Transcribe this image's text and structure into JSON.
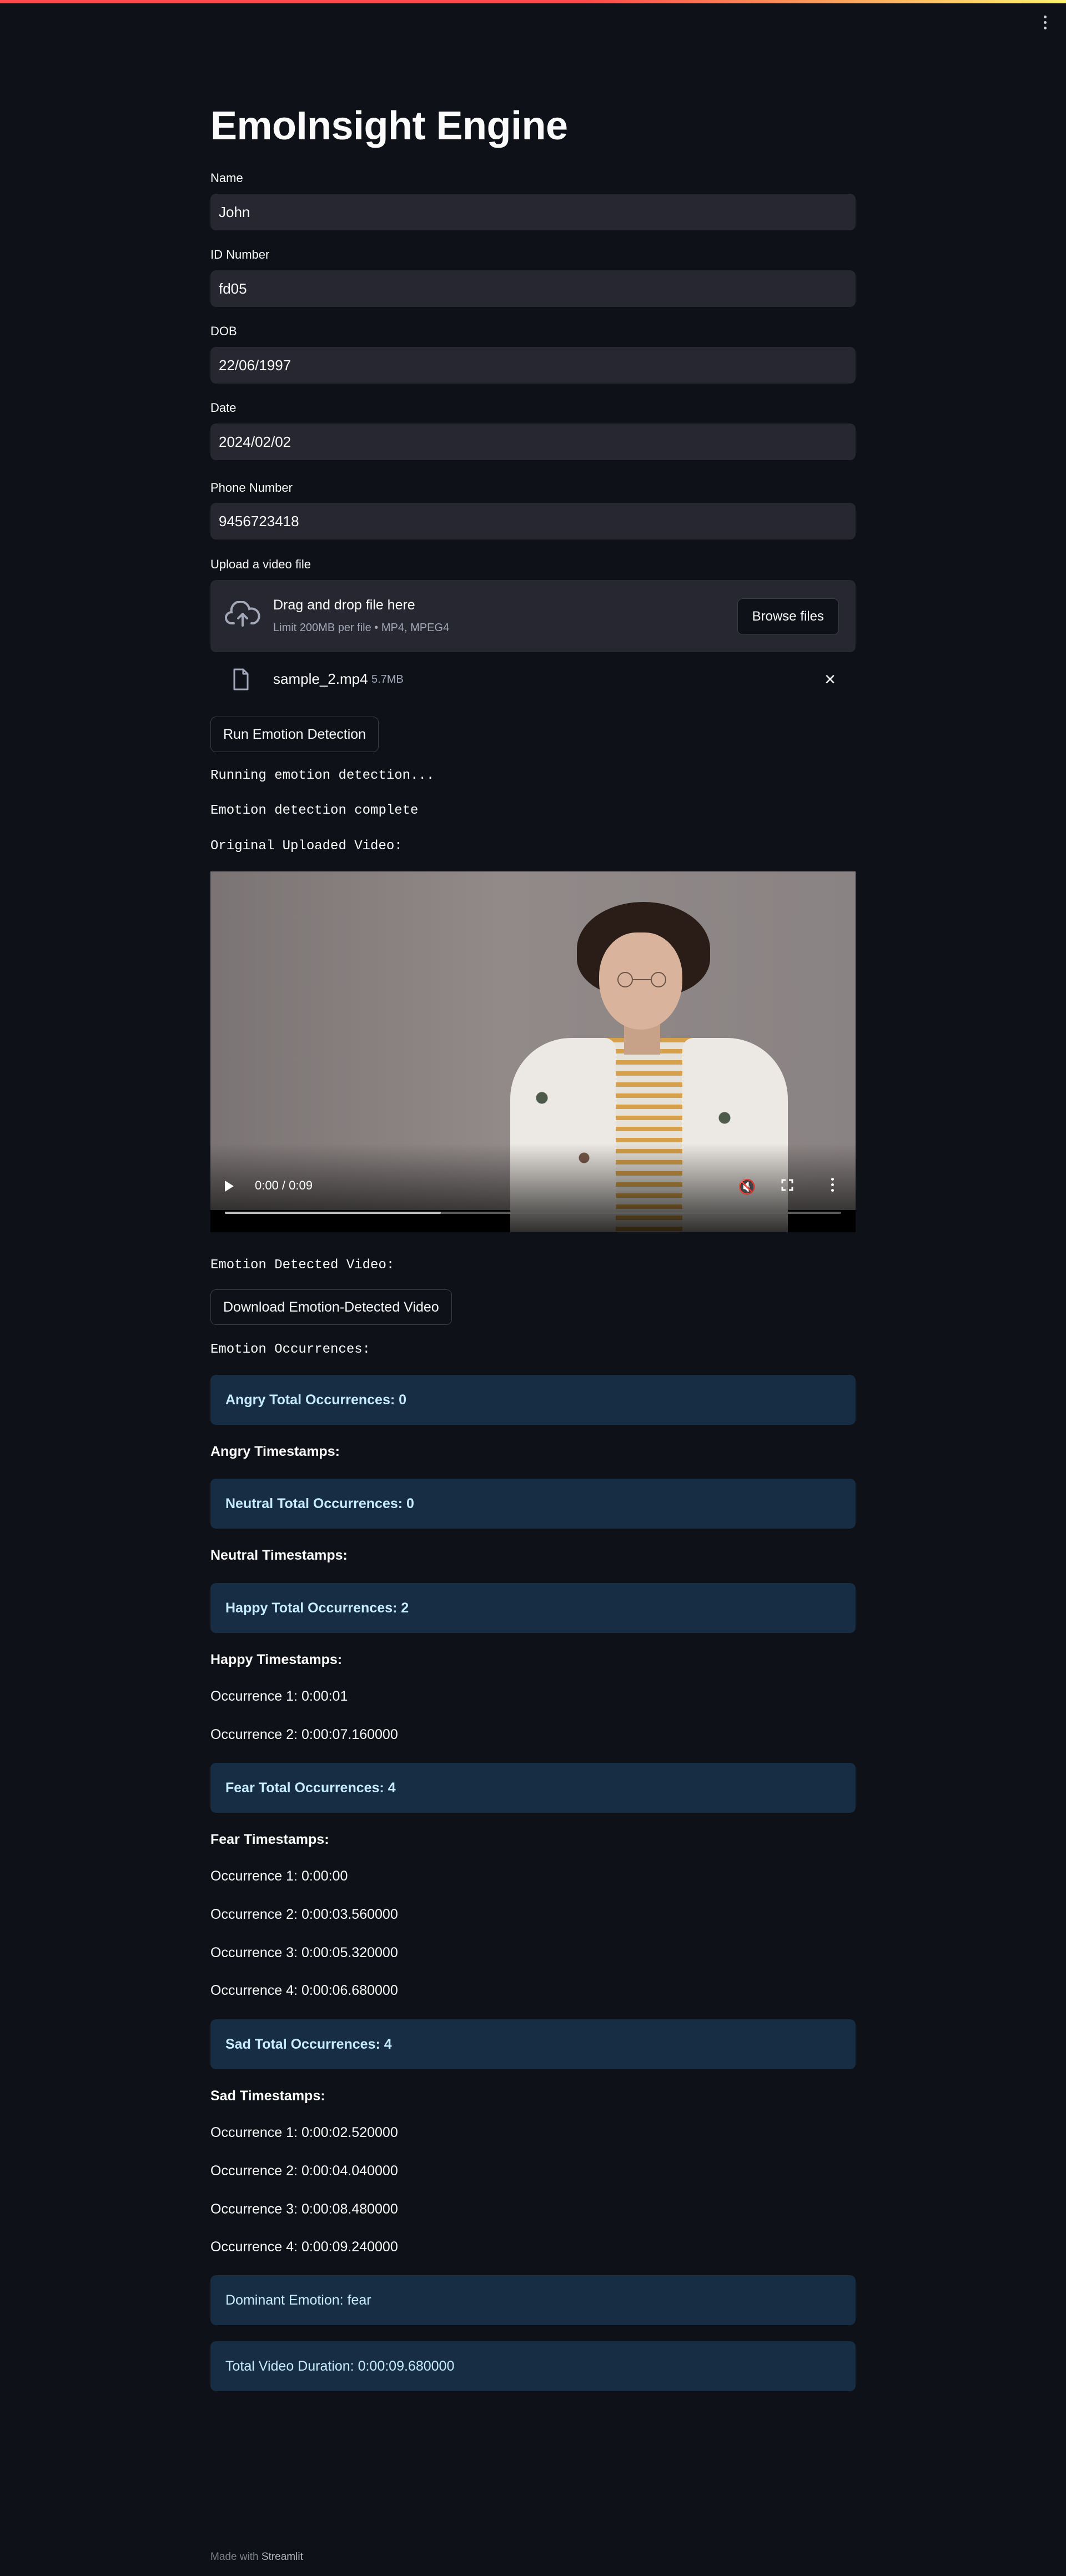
{
  "app": {
    "title": "EmoInsight Engine"
  },
  "fields": [
    {
      "label": "Name",
      "value": "John"
    },
    {
      "label": "ID Number",
      "value": "fd05"
    },
    {
      "label": "DOB",
      "value": "22/06/1997"
    },
    {
      "label": "Date",
      "value": "2024/02/02"
    },
    {
      "label": "Phone Number",
      "value": "9456723418"
    }
  ],
  "uploader": {
    "label": "Upload a video file",
    "drop_title": "Drag and drop file here",
    "drop_limit": "Limit 200MB per file • MP4, MPEG4",
    "browse_label": "Browse files",
    "file_name": "sample_2.mp4",
    "file_size": "5.7MB"
  },
  "run_button": "Run Emotion Detection",
  "status": {
    "running": "Running emotion detection...",
    "complete": "Emotion detection complete",
    "original_video": "Original Uploaded Video:",
    "detected_video": "Emotion Detected Video:",
    "occurrences_header": "Emotion Occurrences:"
  },
  "video": {
    "time": "0:00 / 0:09",
    "buffered_fraction": 0.35
  },
  "download_button": "Download Emotion-Detected Video",
  "emotions": [
    {
      "total": "Angry Total Occurrences: 0",
      "timestamps_header": "Angry Timestamps:",
      "occurrences": []
    },
    {
      "total": "Neutral Total Occurrences: 0",
      "timestamps_header": "Neutral Timestamps:",
      "occurrences": []
    },
    {
      "total": "Happy Total Occurrences: 2",
      "timestamps_header": "Happy Timestamps:",
      "occurrences": [
        "Occurrence 1: 0:00:01",
        "Occurrence 2: 0:00:07.160000"
      ]
    },
    {
      "total": "Fear Total Occurrences: 4",
      "timestamps_header": "Fear Timestamps:",
      "occurrences": [
        "Occurrence 1: 0:00:00",
        "Occurrence 2: 0:00:03.560000",
        "Occurrence 3: 0:00:05.320000",
        "Occurrence 4: 0:00:06.680000"
      ]
    },
    {
      "total": "Sad Total Occurrences: 4",
      "timestamps_header": "Sad Timestamps:",
      "occurrences": [
        "Occurrence 1: 0:00:02.520000",
        "Occurrence 2: 0:00:04.040000",
        "Occurrence 3: 0:00:08.480000",
        "Occurrence 4: 0:00:09.240000"
      ]
    }
  ],
  "summary": {
    "dominant": "Dominant Emotion: fear",
    "duration": "Total Video Duration: 0:00:09.680000"
  },
  "footer": {
    "prefix": "Made with",
    "brand": "Streamlit"
  },
  "colors": {
    "background": "#0e1117",
    "input": "#262730",
    "info_box": "#172d43",
    "info_text": "#c7ebff",
    "accent": "#ff4b4b"
  }
}
